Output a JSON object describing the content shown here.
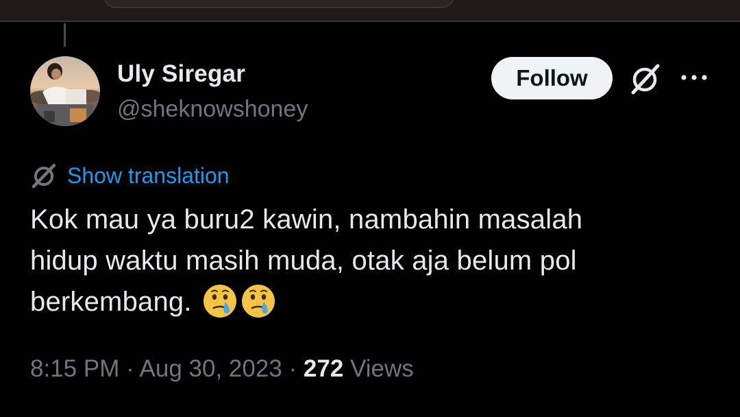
{
  "tweet": {
    "author": {
      "display_name": "Uly Siregar",
      "handle": "@sheknowshoney",
      "avatar_icon": "profile-photo"
    },
    "follow_label": "Follow",
    "header_icons": [
      "grok-icon",
      "more-options-icon"
    ],
    "translate": {
      "icon": "translate-globe-icon",
      "label": "Show translation"
    },
    "text_lines": [
      "Kok mau ya buru2 kawin, nambahin masalah",
      "hidup waktu masih muda, otak aja belum pol",
      "berkembang."
    ],
    "emojis": [
      "face-holding-back-tears-emoji",
      "face-holding-back-tears-emoji"
    ],
    "time": "8:15 PM",
    "separator": "·",
    "date": "Aug 30, 2023",
    "views_count": "272",
    "views_label": "Views"
  },
  "colors": {
    "background": "#000000",
    "text_primary": "#e7e9ea",
    "text_secondary": "#71767b",
    "link": "#1d9bf0",
    "follow_bg": "#eff3f4",
    "top_bar": "#1f1a18"
  }
}
